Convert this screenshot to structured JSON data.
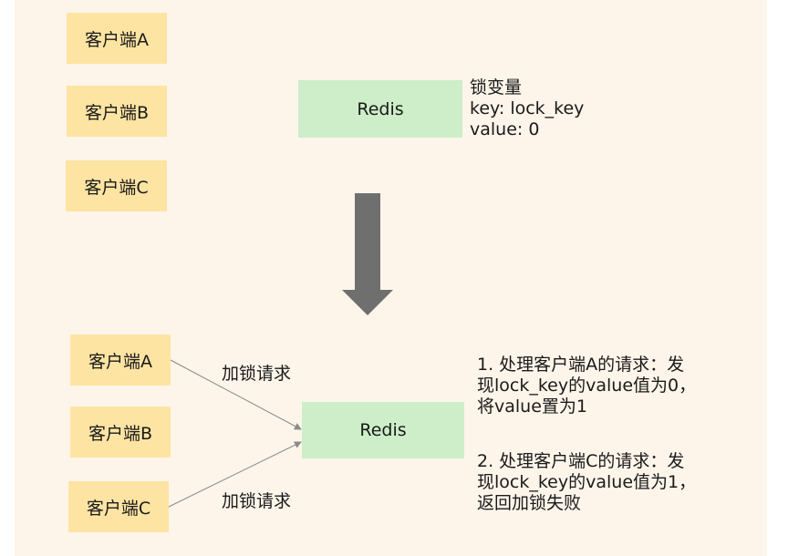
{
  "top": {
    "clients": [
      "客户端A",
      "客户端B",
      "客户端C"
    ],
    "redis": "Redis",
    "lock_info": [
      "锁变量",
      "key: lock_key",
      "value: 0"
    ]
  },
  "bottom": {
    "clients": [
      "客户端A",
      "客户端B",
      "客户端C"
    ],
    "redis": "Redis",
    "request_label_a": "加锁请求",
    "request_label_c": "加锁请求",
    "note1": [
      "1. 处理客户端A的请求：发",
      "现lock_key的value值为0，",
      "将value置为1"
    ],
    "note2": [
      "2. 处理客户端C的请求：发",
      "现lock_key的value值为1，",
      "返回加锁失败"
    ]
  },
  "colors": {
    "background": "#fdf5ea",
    "client_box": "#fde4a3",
    "redis_box": "#cdeec8",
    "big_arrow": "#6f6f6f",
    "connector": "#8a8a8a"
  }
}
